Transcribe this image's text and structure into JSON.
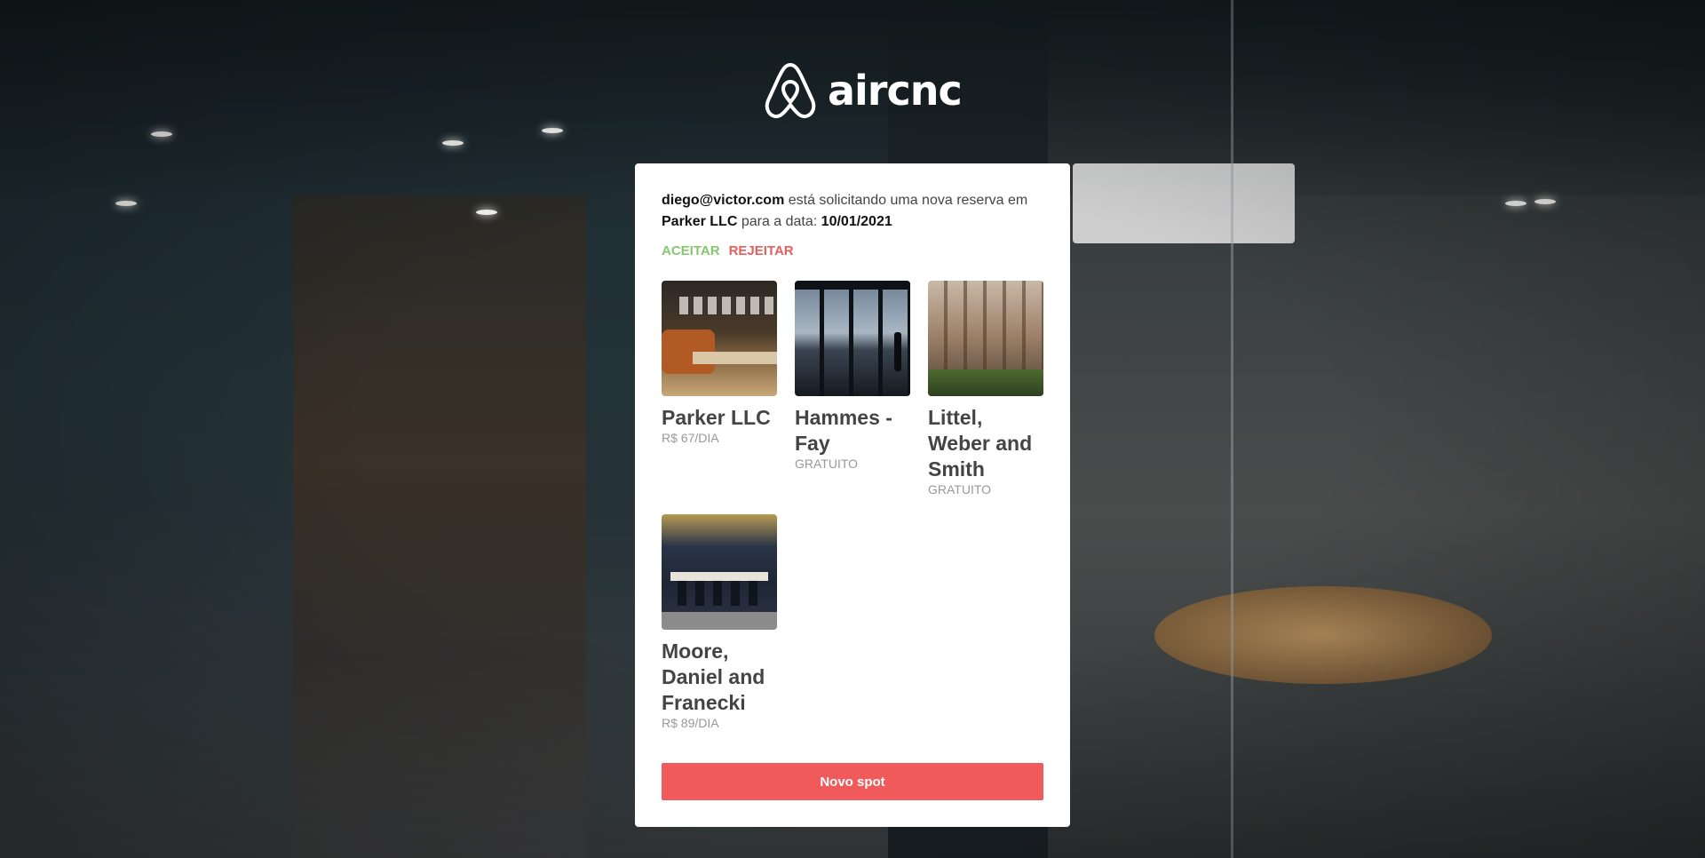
{
  "brand": {
    "name": "aircnc"
  },
  "booking_request": {
    "email": "diego@victor.com",
    "text_1": " está solicitando uma nova reserva em ",
    "spot": "Parker LLC",
    "text_2": " para a data: ",
    "date": "10/01/2021",
    "accept_label": "ACEITAR",
    "reject_label": "REJEITAR"
  },
  "spots": [
    {
      "name": "Parker LLC",
      "price": "R$ 67/DIA"
    },
    {
      "name": "Hammes - Fay",
      "price": "GRATUITO"
    },
    {
      "name": "Littel, Weber and Smith",
      "price": "GRATUITO"
    },
    {
      "name": "Moore, Daniel and Franecki",
      "price": "R$ 89/DIA"
    }
  ],
  "new_spot_label": "Novo spot",
  "colors": {
    "accept": "#84c870",
    "reject": "#e55e5e",
    "primary": "#f05a5b"
  }
}
